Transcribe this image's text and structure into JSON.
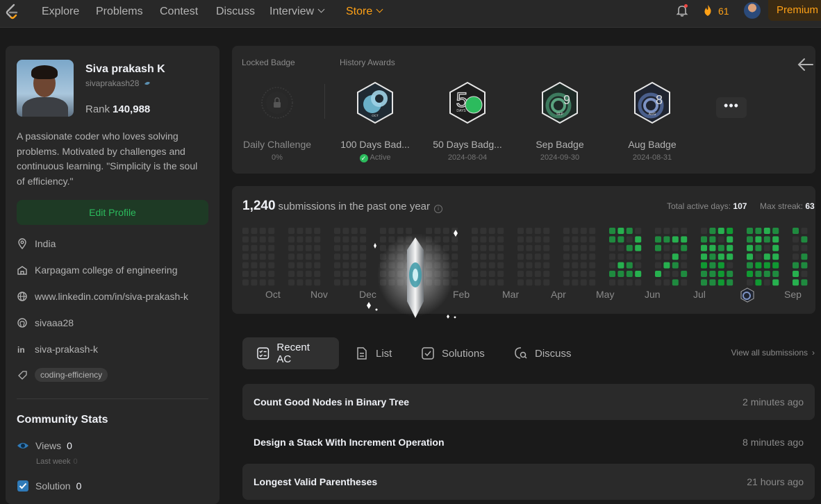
{
  "nav": {
    "items": [
      "Explore",
      "Problems",
      "Contest",
      "Discuss",
      "Interview"
    ],
    "store": "Store",
    "streak": "61",
    "premium": "Premium"
  },
  "profile": {
    "name": "Siva prakash K",
    "username": "sivaprakash28",
    "rank_label": "Rank",
    "rank": "140,988",
    "bio": "A passionate coder who loves solving problems. Motivated by challenges and continuous learning. \"Simplicity is the soul of efficiency.\"",
    "edit_label": "Edit Profile",
    "location": "India",
    "college": "Karpagam college of engineering",
    "website": "www.linkedin.com/in/siva-prakash-k",
    "github": "sivaaa28",
    "linkedin": "siva-prakash-k",
    "tag": "coding-efficiency"
  },
  "community": {
    "title": "Community Stats",
    "views_label": "Views",
    "views": "0",
    "last_week_label": "Last week",
    "last_week": "0",
    "solution_label": "Solution",
    "solution": "0"
  },
  "badges": {
    "locked_label": "Locked Badge",
    "history_label": "History Awards",
    "items": [
      {
        "name": "Daily Challenge",
        "sub": "0%"
      },
      {
        "name": "100 Days Bad...",
        "sub": "Active"
      },
      {
        "name": "50 Days Badg...",
        "sub": "2024-08-04"
      },
      {
        "name": "Sep Badge",
        "sub": "2024-09-30"
      },
      {
        "name": "Aug Badge",
        "sub": "2024-08-31"
      }
    ],
    "more": "•••"
  },
  "heatmap": {
    "count": "1,240",
    "count_text": "submissions in the past one year",
    "active_label": "Total active days:",
    "active_days": "107",
    "streak_label": "Max streak:",
    "max_streak": "63",
    "months": [
      "Oct",
      "Nov",
      "Dec",
      "Feb",
      "Mar",
      "Apr",
      "May",
      "Jun",
      "Jul",
      "Sep"
    ]
  },
  "tabs": {
    "recent": "Recent AC",
    "list": "List",
    "solutions": "Solutions",
    "discuss": "Discuss",
    "view_all": "View all submissions"
  },
  "submissions": [
    {
      "title": "Count Good Nodes in Binary Tree",
      "time": "2 minutes ago"
    },
    {
      "title": "Design a Stack With Increment Operation",
      "time": "8 minutes ago"
    },
    {
      "title": "Longest Valid Parentheses",
      "time": "21 hours ago"
    }
  ],
  "colors": {
    "accent": "#ffa116",
    "green": "#2cbb5d",
    "panel": "#282828",
    "background": "#1a1a1a"
  }
}
